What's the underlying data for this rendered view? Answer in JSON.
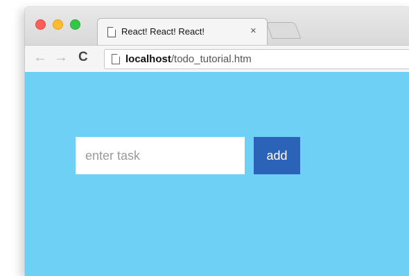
{
  "browser": {
    "tab": {
      "title": "React! React! React!",
      "close_label": "×",
      "doc_icon": "document-icon"
    },
    "toolbar": {
      "back_label": "←",
      "forward_label": "→",
      "reload_label": "C",
      "url_host": "localhost",
      "url_path": "/todo_tutorial.htm"
    },
    "colors": {
      "close": "#fc5f57",
      "minimize": "#fdbc2e",
      "zoom": "#33c748"
    }
  },
  "app": {
    "background_color": "#6dd0f4",
    "input": {
      "placeholder": "enter task",
      "value": ""
    },
    "add_button": {
      "label": "add",
      "color": "#2a63b8"
    }
  }
}
